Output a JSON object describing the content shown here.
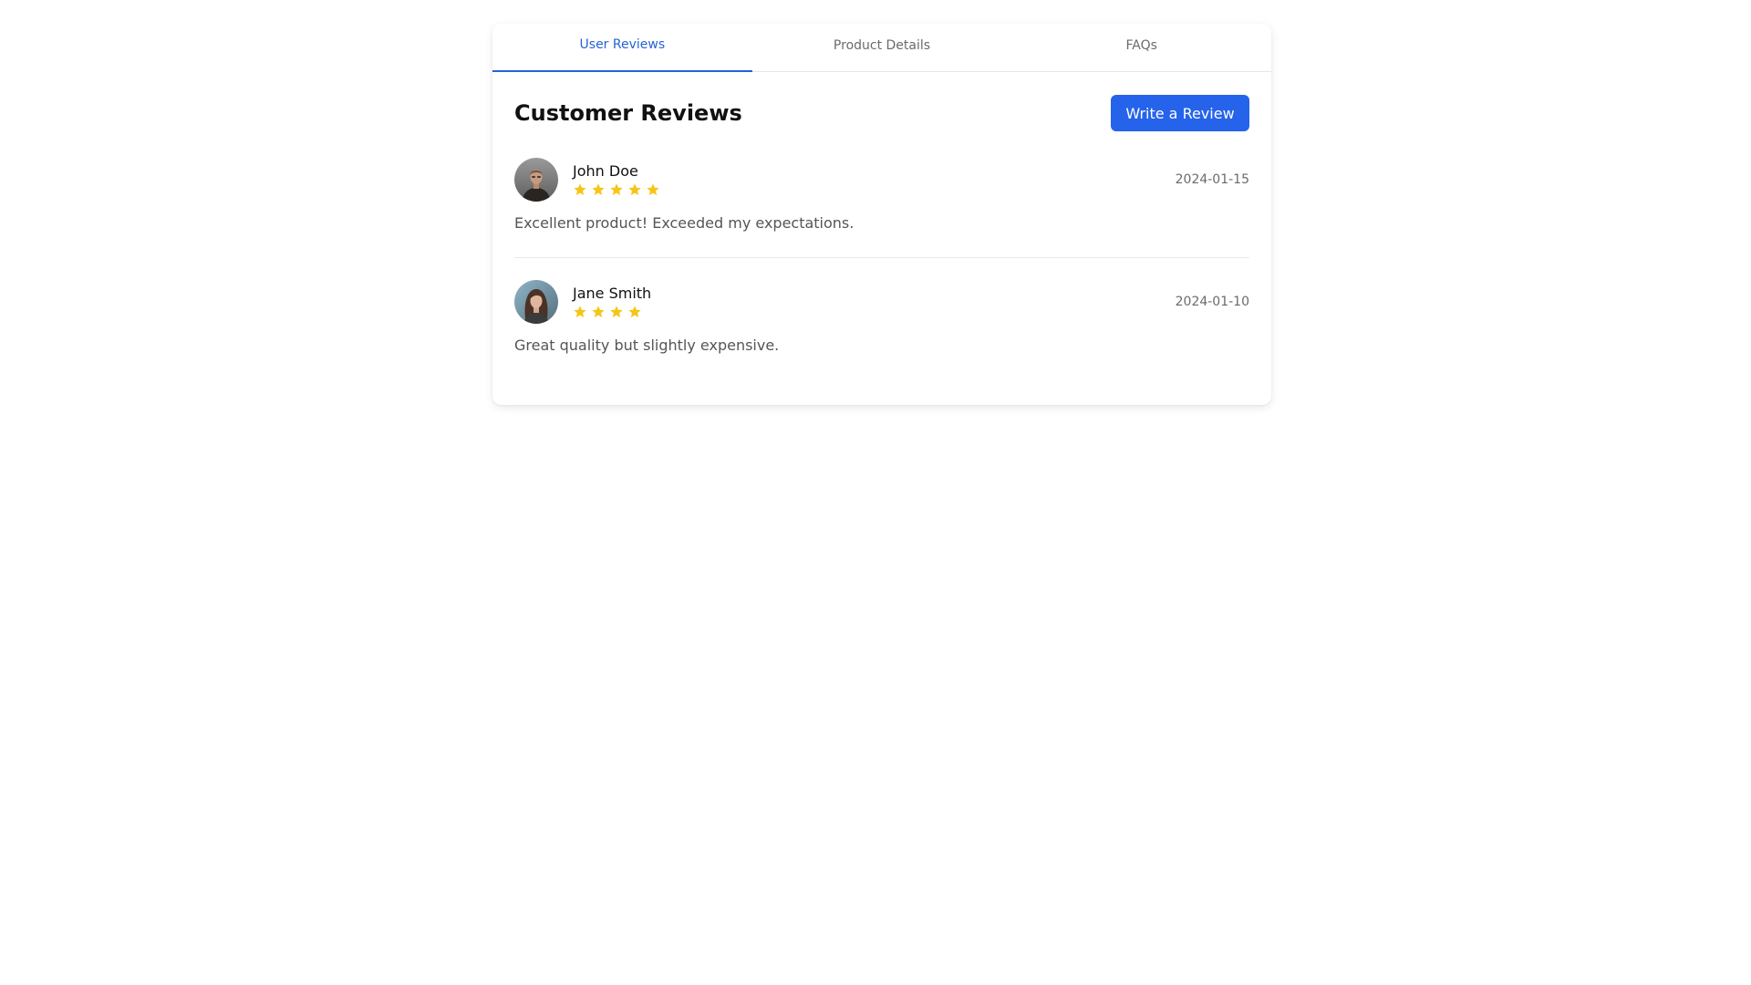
{
  "tabs": [
    {
      "label": "User Reviews",
      "active": true
    },
    {
      "label": "Product Details",
      "active": false
    },
    {
      "label": "FAQs",
      "active": false
    }
  ],
  "section_title": "Customer Reviews",
  "write_review_label": "Write a Review",
  "colors": {
    "accent": "#2563eb",
    "star": "#f5c518"
  },
  "reviews": [
    {
      "name": "John Doe",
      "rating": 5,
      "date": "2024-01-15",
      "text": "Excellent product! Exceeded my expectations.",
      "avatar_icon": "avatar-man-photo"
    },
    {
      "name": "Jane Smith",
      "rating": 4,
      "date": "2024-01-10",
      "text": "Great quality but slightly expensive.",
      "avatar_icon": "avatar-woman-photo"
    }
  ]
}
